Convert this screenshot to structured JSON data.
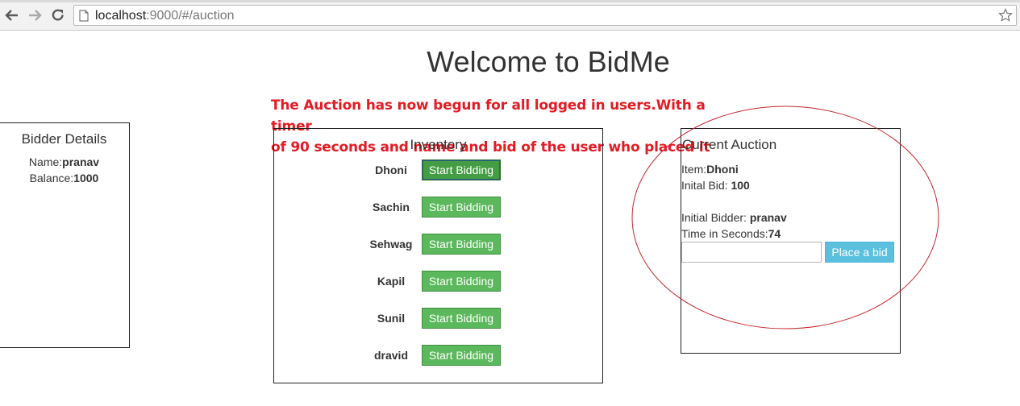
{
  "browser": {
    "url_host": "localhost",
    "url_rest": ":9000/#/auction"
  },
  "page": {
    "title": "Welcome to BidMe"
  },
  "annotation": {
    "line1": "The Auction has now begun for all logged in users.With a timer",
    "line2": "of 90 seconds and name and bid of the user who placed it"
  },
  "bidder": {
    "heading": "Bidder Details",
    "name_label": "Name:",
    "name_value": "pranav",
    "balance_label": "Balance:",
    "balance_value": "1000"
  },
  "inventory": {
    "heading": "Inventory",
    "button_label": "Start Bidding",
    "items": [
      {
        "name": "Dhoni"
      },
      {
        "name": "Sachin"
      },
      {
        "name": "Sehwag"
      },
      {
        "name": "Kapil"
      },
      {
        "name": "Sunil"
      },
      {
        "name": "dravid"
      }
    ]
  },
  "auction": {
    "heading": "Current Auction",
    "item_label": "Item:",
    "item_value": "Dhoni",
    "initial_bid_label": "Inital Bid: ",
    "initial_bid_value": "100",
    "initial_bidder_label": "Initial Bidder: ",
    "initial_bidder_value": "pranav",
    "time_label": "Time in Seconds:",
    "time_value": "74",
    "bid_input_value": "",
    "place_bid_label": "Place a bid"
  },
  "colors": {
    "annotation": "#e31b23",
    "start_button": "#5cb85c",
    "place_button": "#5bc0de"
  },
  "icons": [
    "back-icon",
    "forward-icon",
    "reload-icon",
    "page-icon",
    "star-icon"
  ]
}
